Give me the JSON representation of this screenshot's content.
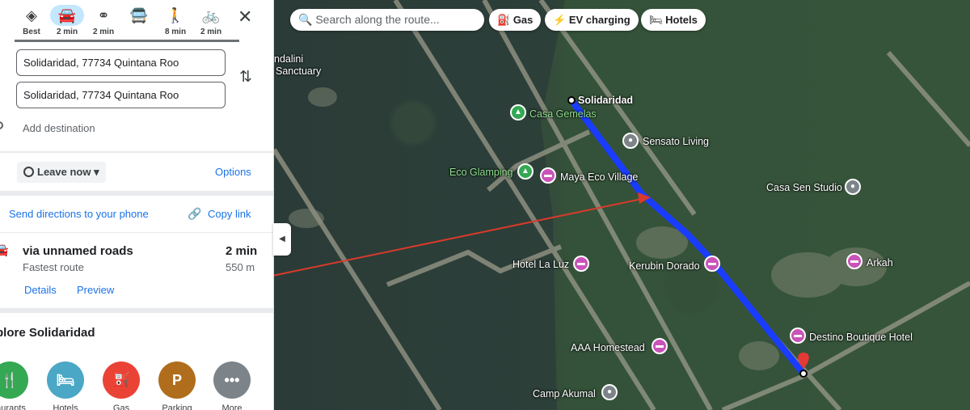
{
  "travel_modes": [
    {
      "label": "Best",
      "icon": "diamond-route-icon",
      "glyph": "◈"
    },
    {
      "label": "2 min",
      "icon": "car-icon",
      "glyph": "🚘"
    },
    {
      "label": "2 min",
      "icon": "motorcycle-icon",
      "glyph": "⚭"
    },
    {
      "label": "",
      "icon": "transit-icon",
      "glyph": "🚍"
    },
    {
      "label": "8 min",
      "icon": "walking-icon",
      "glyph": "🚶"
    },
    {
      "label": "2 min",
      "icon": "bicycle-icon",
      "glyph": "🚲"
    }
  ],
  "close_glyph": "✕",
  "origin": {
    "value": "Solidaridad, 77734 Quintana Roo"
  },
  "destination": {
    "value": "Solidaridad, 77734 Quintana Roo"
  },
  "swap_glyph": "⇅",
  "add_destination": "Add destination",
  "leave_now": "Leave now",
  "options": "Options",
  "send_directions": "Send directions to your phone",
  "copy_link": "Copy link",
  "route": {
    "name": "via unnamed roads",
    "time": "2 min",
    "subtitle": "Fastest route",
    "distance": "550 m",
    "details": "Details",
    "preview": "Preview"
  },
  "explore_title": "plore Solidaridad",
  "categories": [
    {
      "label": "taurants",
      "icon": "restaurant-icon",
      "glyph": "🍴",
      "color": "#34a853"
    },
    {
      "label": "Hotels",
      "icon": "hotel-icon",
      "glyph": "🛏",
      "color": "#4aa7c5"
    },
    {
      "label": "Gas",
      "icon": "gas-icon",
      "glyph": "⛽",
      "color": "#ea4335"
    },
    {
      "label": "Parking",
      "icon": "parking-icon",
      "glyph": "P",
      "color": "#b06d1b"
    },
    {
      "label": "More",
      "icon": "more-icon",
      "glyph": "•••",
      "color": "#7d8489"
    }
  ],
  "map": {
    "search_placeholder": "Search along the route...",
    "chips": [
      "Gas",
      "EV charging",
      "Hotels"
    ],
    "places": {
      "solidaridad": "Solidaridad",
      "casa_gemelas": "Casa Gemelas",
      "sensato": "Sensato Living",
      "eco_glamping": "Eco Glamping",
      "maya_eco": "Maya Eco Village",
      "casa_sen": "Casa Sen Studio",
      "hotel_la_luz": "Hotel La Luz",
      "kerubin": "Kerubin Dorado",
      "arkah": "Arkah",
      "destino": "Destino Boutique Hotel",
      "aaa": "AAA Homestead",
      "camp": "Camp Akumal",
      "sanctuary_1": "ndalini",
      "sanctuary_2": "Sanctuary"
    },
    "colors": {
      "route": "#1a3cff",
      "arrow": "#d93a2b",
      "destination_pin": "#e53935"
    }
  }
}
